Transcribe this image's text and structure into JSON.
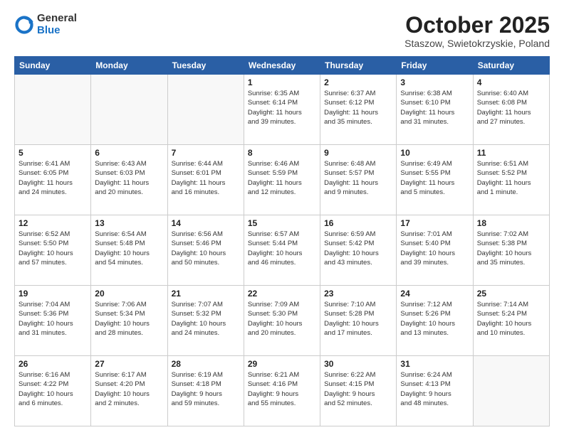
{
  "header": {
    "logo_general": "General",
    "logo_blue": "Blue",
    "title": "October 2025",
    "subtitle": "Staszow, Swietokrzyskie, Poland"
  },
  "weekdays": [
    "Sunday",
    "Monday",
    "Tuesday",
    "Wednesday",
    "Thursday",
    "Friday",
    "Saturday"
  ],
  "weeks": [
    [
      {
        "day": "",
        "info": ""
      },
      {
        "day": "",
        "info": ""
      },
      {
        "day": "",
        "info": ""
      },
      {
        "day": "1",
        "info": "Sunrise: 6:35 AM\nSunset: 6:14 PM\nDaylight: 11 hours\nand 39 minutes."
      },
      {
        "day": "2",
        "info": "Sunrise: 6:37 AM\nSunset: 6:12 PM\nDaylight: 11 hours\nand 35 minutes."
      },
      {
        "day": "3",
        "info": "Sunrise: 6:38 AM\nSunset: 6:10 PM\nDaylight: 11 hours\nand 31 minutes."
      },
      {
        "day": "4",
        "info": "Sunrise: 6:40 AM\nSunset: 6:08 PM\nDaylight: 11 hours\nand 27 minutes."
      }
    ],
    [
      {
        "day": "5",
        "info": "Sunrise: 6:41 AM\nSunset: 6:05 PM\nDaylight: 11 hours\nand 24 minutes."
      },
      {
        "day": "6",
        "info": "Sunrise: 6:43 AM\nSunset: 6:03 PM\nDaylight: 11 hours\nand 20 minutes."
      },
      {
        "day": "7",
        "info": "Sunrise: 6:44 AM\nSunset: 6:01 PM\nDaylight: 11 hours\nand 16 minutes."
      },
      {
        "day": "8",
        "info": "Sunrise: 6:46 AM\nSunset: 5:59 PM\nDaylight: 11 hours\nand 12 minutes."
      },
      {
        "day": "9",
        "info": "Sunrise: 6:48 AM\nSunset: 5:57 PM\nDaylight: 11 hours\nand 9 minutes."
      },
      {
        "day": "10",
        "info": "Sunrise: 6:49 AM\nSunset: 5:55 PM\nDaylight: 11 hours\nand 5 minutes."
      },
      {
        "day": "11",
        "info": "Sunrise: 6:51 AM\nSunset: 5:52 PM\nDaylight: 11 hours\nand 1 minute."
      }
    ],
    [
      {
        "day": "12",
        "info": "Sunrise: 6:52 AM\nSunset: 5:50 PM\nDaylight: 10 hours\nand 57 minutes."
      },
      {
        "day": "13",
        "info": "Sunrise: 6:54 AM\nSunset: 5:48 PM\nDaylight: 10 hours\nand 54 minutes."
      },
      {
        "day": "14",
        "info": "Sunrise: 6:56 AM\nSunset: 5:46 PM\nDaylight: 10 hours\nand 50 minutes."
      },
      {
        "day": "15",
        "info": "Sunrise: 6:57 AM\nSunset: 5:44 PM\nDaylight: 10 hours\nand 46 minutes."
      },
      {
        "day": "16",
        "info": "Sunrise: 6:59 AM\nSunset: 5:42 PM\nDaylight: 10 hours\nand 43 minutes."
      },
      {
        "day": "17",
        "info": "Sunrise: 7:01 AM\nSunset: 5:40 PM\nDaylight: 10 hours\nand 39 minutes."
      },
      {
        "day": "18",
        "info": "Sunrise: 7:02 AM\nSunset: 5:38 PM\nDaylight: 10 hours\nand 35 minutes."
      }
    ],
    [
      {
        "day": "19",
        "info": "Sunrise: 7:04 AM\nSunset: 5:36 PM\nDaylight: 10 hours\nand 31 minutes."
      },
      {
        "day": "20",
        "info": "Sunrise: 7:06 AM\nSunset: 5:34 PM\nDaylight: 10 hours\nand 28 minutes."
      },
      {
        "day": "21",
        "info": "Sunrise: 7:07 AM\nSunset: 5:32 PM\nDaylight: 10 hours\nand 24 minutes."
      },
      {
        "day": "22",
        "info": "Sunrise: 7:09 AM\nSunset: 5:30 PM\nDaylight: 10 hours\nand 20 minutes."
      },
      {
        "day": "23",
        "info": "Sunrise: 7:10 AM\nSunset: 5:28 PM\nDaylight: 10 hours\nand 17 minutes."
      },
      {
        "day": "24",
        "info": "Sunrise: 7:12 AM\nSunset: 5:26 PM\nDaylight: 10 hours\nand 13 minutes."
      },
      {
        "day": "25",
        "info": "Sunrise: 7:14 AM\nSunset: 5:24 PM\nDaylight: 10 hours\nand 10 minutes."
      }
    ],
    [
      {
        "day": "26",
        "info": "Sunrise: 6:16 AM\nSunset: 4:22 PM\nDaylight: 10 hours\nand 6 minutes."
      },
      {
        "day": "27",
        "info": "Sunrise: 6:17 AM\nSunset: 4:20 PM\nDaylight: 10 hours\nand 2 minutes."
      },
      {
        "day": "28",
        "info": "Sunrise: 6:19 AM\nSunset: 4:18 PM\nDaylight: 9 hours\nand 59 minutes."
      },
      {
        "day": "29",
        "info": "Sunrise: 6:21 AM\nSunset: 4:16 PM\nDaylight: 9 hours\nand 55 minutes."
      },
      {
        "day": "30",
        "info": "Sunrise: 6:22 AM\nSunset: 4:15 PM\nDaylight: 9 hours\nand 52 minutes."
      },
      {
        "day": "31",
        "info": "Sunrise: 6:24 AM\nSunset: 4:13 PM\nDaylight: 9 hours\nand 48 minutes."
      },
      {
        "day": "",
        "info": ""
      }
    ]
  ]
}
